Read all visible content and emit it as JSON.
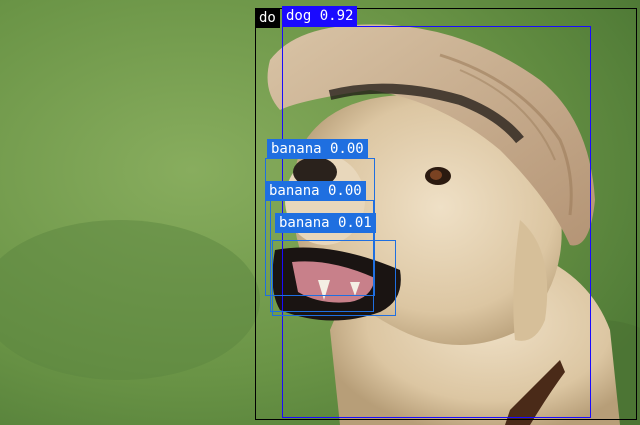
{
  "detections": [
    {
      "label": "do",
      "color": "#000000"
    },
    {
      "label": "dog 0.92",
      "color": "#1a0aff"
    },
    {
      "label": "banana 0.00",
      "color": "#1f6fe0"
    },
    {
      "label": "banana 0.00",
      "color": "#1f6fe0"
    },
    {
      "label": "banana 0.01",
      "color": "#1f6fe0"
    }
  ],
  "scene": {
    "subject": "yellow labrador dog wearing a tan bucket hat, mouth open",
    "background": "blurred green grass"
  }
}
